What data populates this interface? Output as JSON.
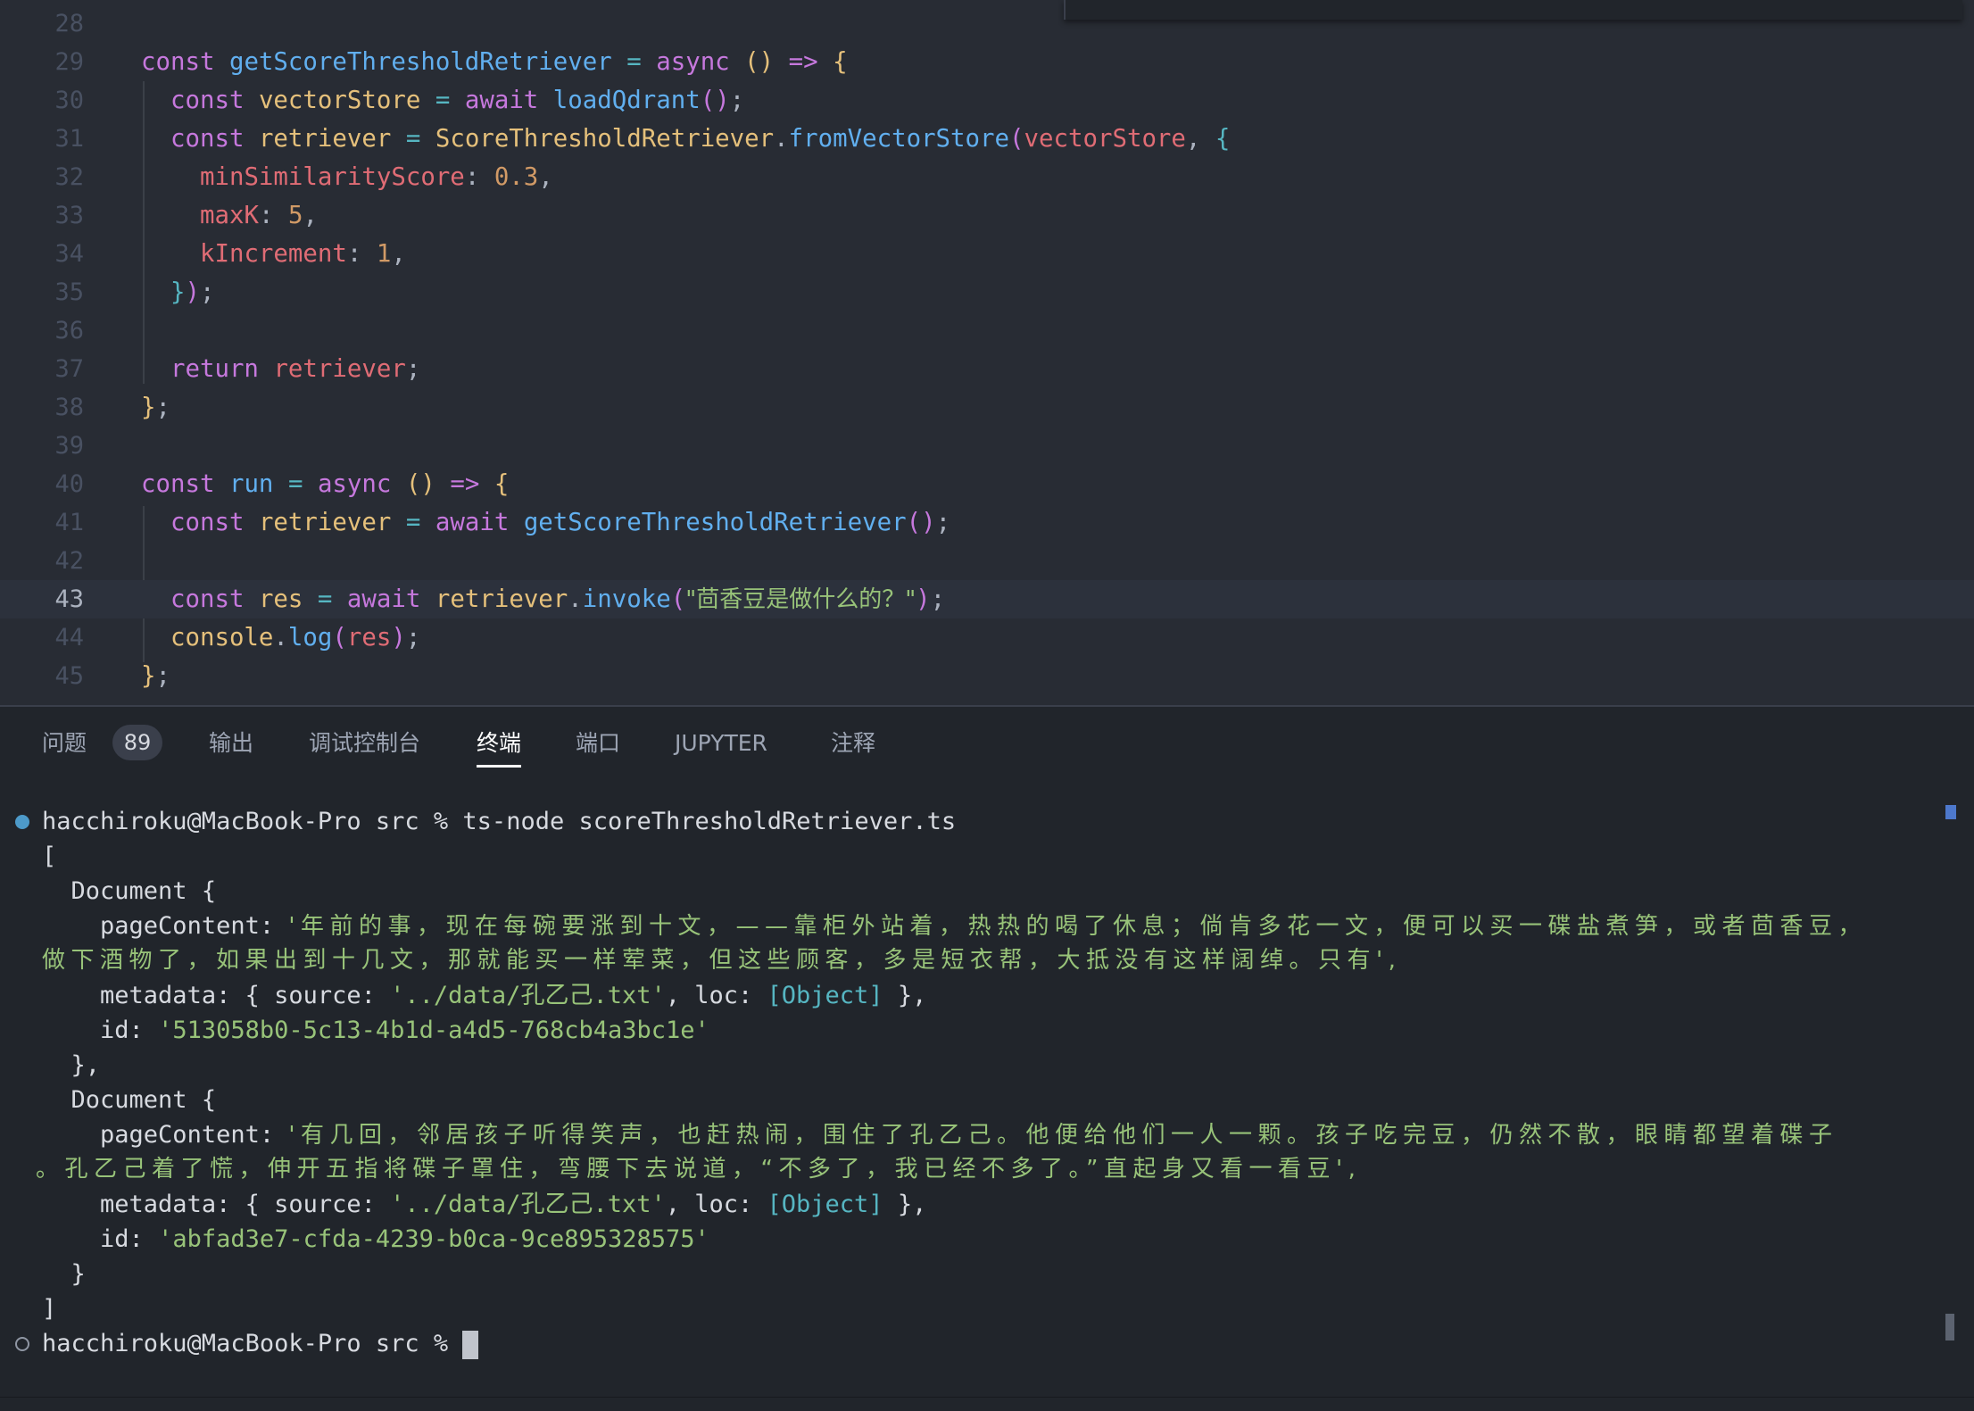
{
  "editor": {
    "lines": [
      {
        "n": "28"
      },
      {
        "n": "29"
      },
      {
        "n": "30"
      },
      {
        "n": "31"
      },
      {
        "n": "32"
      },
      {
        "n": "33"
      },
      {
        "n": "34"
      },
      {
        "n": "35"
      },
      {
        "n": "36"
      },
      {
        "n": "37"
      },
      {
        "n": "38"
      },
      {
        "n": "39"
      },
      {
        "n": "40"
      },
      {
        "n": "41"
      },
      {
        "n": "42"
      },
      {
        "n": "43"
      },
      {
        "n": "44"
      },
      {
        "n": "45"
      }
    ],
    "current_line": "43",
    "code": {
      "l29": [
        "const",
        "getScoreThresholdRetriever",
        "=",
        "async",
        "(",
        ")",
        "=>",
        "{"
      ],
      "l30": [
        "const",
        "vectorStore",
        "=",
        "await",
        "loadQdrant",
        "(",
        ")",
        ";"
      ],
      "l31": [
        "const",
        "retriever",
        "=",
        "ScoreThresholdRetriever",
        ".",
        "fromVectorStore",
        "(",
        "vectorStore",
        ",",
        "{"
      ],
      "l32": [
        "minSimilarityScore",
        ":",
        "0.3",
        ","
      ],
      "l33": [
        "maxK",
        ":",
        "5",
        ","
      ],
      "l34": [
        "kIncrement",
        ":",
        "1",
        ","
      ],
      "l35": [
        "}",
        ")",
        ";"
      ],
      "l37": [
        "return",
        "retriever",
        ";"
      ],
      "l38": [
        "}",
        ";"
      ],
      "l40": [
        "const",
        "run",
        "=",
        "async",
        "(",
        ")",
        "=>",
        "{"
      ],
      "l41": [
        "const",
        "retriever",
        "=",
        "await",
        "getScoreThresholdRetriever",
        "(",
        ")",
        ";"
      ],
      "l43": [
        "const",
        "res",
        "=",
        "await",
        "retriever",
        ".",
        "invoke",
        "(",
        "\"茴香豆是做什么的？\"",
        ")",
        ";"
      ],
      "l44": [
        "console",
        ".",
        "log",
        "(",
        "res",
        ")",
        ";"
      ],
      "l45": [
        "}",
        ";"
      ]
    }
  },
  "panel": {
    "tabs": [
      {
        "label": "问题"
      },
      {
        "label": "输出"
      },
      {
        "label": "调试控制台"
      },
      {
        "label": "终端"
      },
      {
        "label": "端口"
      },
      {
        "label": "JUPYTER"
      },
      {
        "label": "注释"
      }
    ],
    "problems_count": "89",
    "active_tab": "终端"
  },
  "terminal": {
    "prompt": "hacchiroku@MacBook-Pro src %",
    "command": "ts-node scoreThresholdRetriever.ts",
    "output": {
      "open_bracket": "[",
      "doc_open": "Document {",
      "page_key": "pageContent: ",
      "doc1_content_a": "'年前的事，现在每碗要涨到十文，——靠柜外站着，热热的喝了休息；倘肯多花一文，便可以买一碟盐煮笋，或者茴香豆，",
      "doc1_content_b": "做下酒物了，如果出到十几文，那就能买一样荤菜，但这些顾客，多是短衣帮，大抵没有这样阔绰。只有',",
      "meta_a": "metadata: { source: ",
      "meta_source": "'../data/孔乙己.txt'",
      "meta_b": ", loc: ",
      "meta_obj": "[Object]",
      "meta_c": " },",
      "id_key": "id: ",
      "doc1_id": "'513058b0-5c13-4b1d-a4d5-768cb4a3bc1e'",
      "doc1_close": "},",
      "doc2_content_a": "'有几回，邻居孩子听得笑声，也赶热闹，围住了孔乙己。他便给他们一人一颗。孩子吃完豆，仍然不散，眼睛都望着碟子",
      "doc2_content_b": "。孔乙己着了慌，伸开五指将碟子罩住，弯腰下去说道，“不多了，我已经不多了。”直起身又看一看豆',",
      "doc2_id": "'abfad3e7-cfda-4239-b0ca-9ce895328575'",
      "doc2_close": "}",
      "close_bracket": "]"
    }
  },
  "colors": {
    "editor_bg": "#282c34",
    "panel_bg": "#21252b",
    "keyword": "#c678dd",
    "function": "#61afef",
    "variable": "#e5c07b",
    "property": "#e06c75",
    "number": "#d19a66",
    "string": "#98c379",
    "operator": "#56b6c2"
  }
}
